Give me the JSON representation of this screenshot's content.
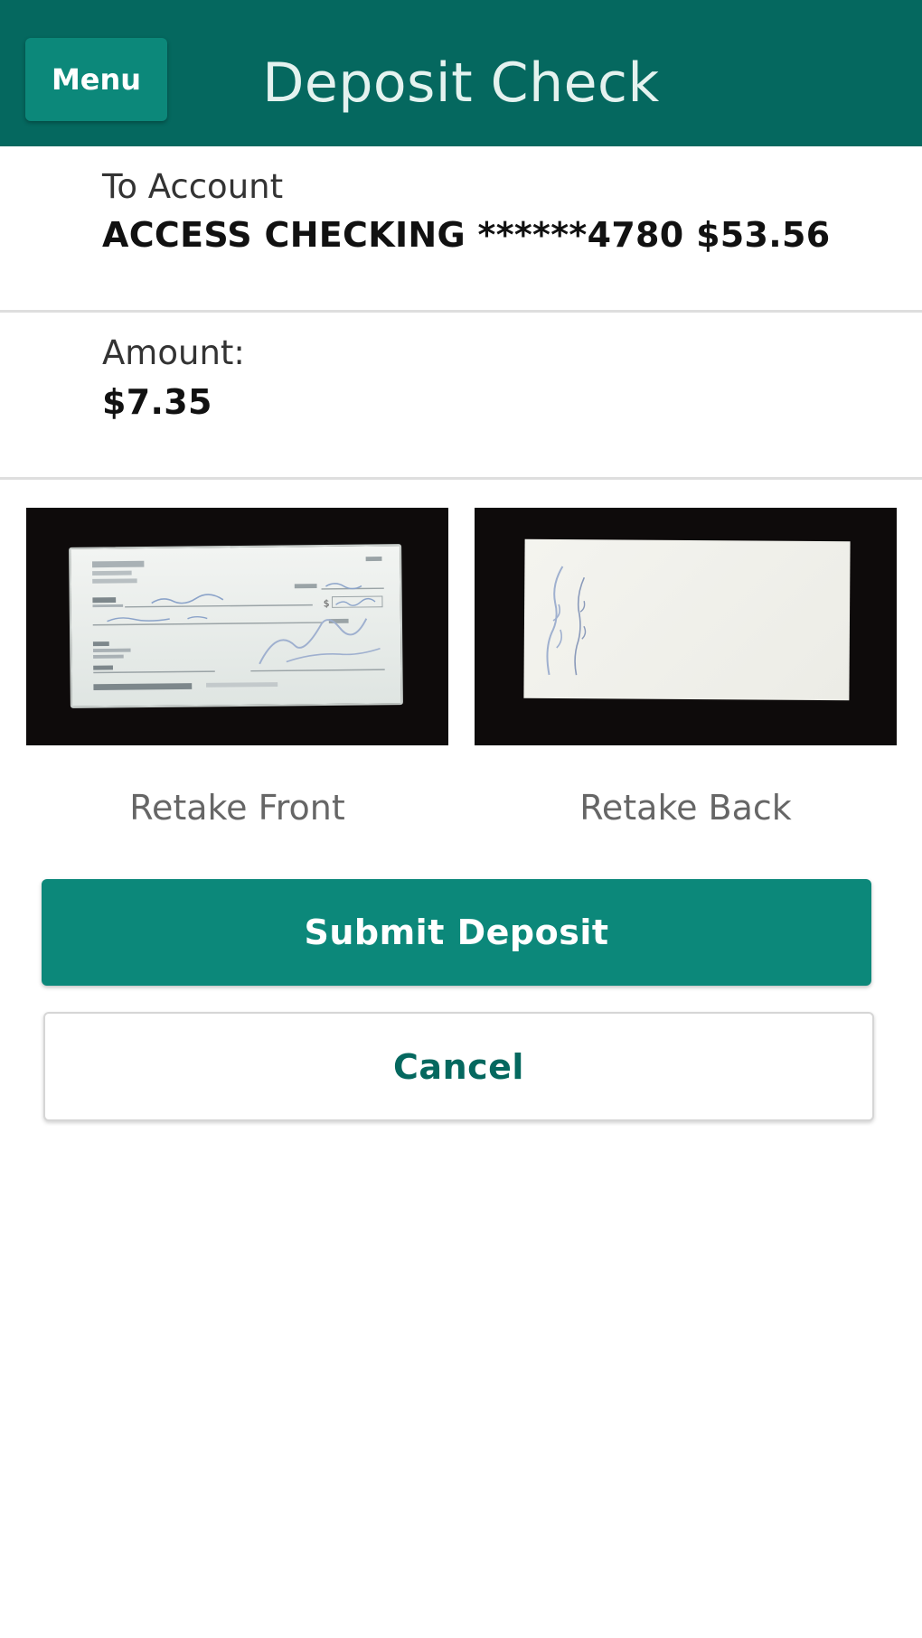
{
  "header": {
    "menu_label": "Menu",
    "title": "Deposit Check"
  },
  "to_account": {
    "label": "To Account",
    "value": "ACCESS CHECKING ******4780 $53.56"
  },
  "amount": {
    "label": "Amount:",
    "value": "$7.35"
  },
  "images": {
    "front_icon": "check-front-image",
    "back_icon": "check-back-image"
  },
  "actions": {
    "retake_front": "Retake Front",
    "retake_back": "Retake Back",
    "submit": "Submit Deposit",
    "cancel": "Cancel"
  },
  "colors": {
    "header": "#05685f",
    "accent": "#0c887a"
  }
}
